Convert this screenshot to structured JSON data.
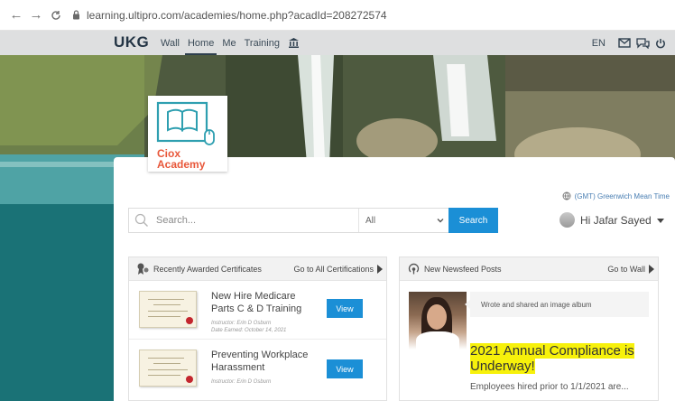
{
  "browser": {
    "back": "←",
    "forward": "→",
    "reload": "C",
    "url": "learning.ultipro.com/academies/home.php?acadId=208272574"
  },
  "nav": {
    "logo": "UKG",
    "links": [
      "Wall",
      "Home",
      "Me",
      "Training"
    ],
    "active": "Home",
    "language": "EN"
  },
  "academy": {
    "name_line1": "Ciox",
    "name_line2": "Academy",
    "brand_color": "#e8573a",
    "icon_color": "#2e9fb0"
  },
  "timezone": "(GMT) Greenwich Mean Time",
  "search": {
    "placeholder": "Search...",
    "filter_value": "All",
    "button_label": "Search"
  },
  "user": {
    "greeting": "Hi Jafar Sayed"
  },
  "certificates": {
    "title": "Recently Awarded Certificates",
    "link": "Go to All Certifications",
    "items": [
      {
        "title": "New Hire Medicare Parts C & D Training",
        "instructor": "Instructor: Erin D Osburn",
        "earned": "Date Earned: October 14, 2021",
        "button": "View"
      },
      {
        "title": "Preventing Workplace Harassment",
        "instructor": "Instructor: Erin D Osburn",
        "earned": "",
        "button": "View"
      }
    ]
  },
  "newsfeed": {
    "title": "New Newsfeed Posts",
    "link": "Go to Wall",
    "post": {
      "activity": "Wrote and shared an image album",
      "headline": "2021 Annual Compliance is Underway!",
      "excerpt": "Employees hired prior to 1/1/2021 are..."
    }
  },
  "colors": {
    "accent": "#1b8fd6",
    "highlight": "#f7f10b",
    "nav_bg": "#dedfe0",
    "teal": "#1a7276"
  }
}
